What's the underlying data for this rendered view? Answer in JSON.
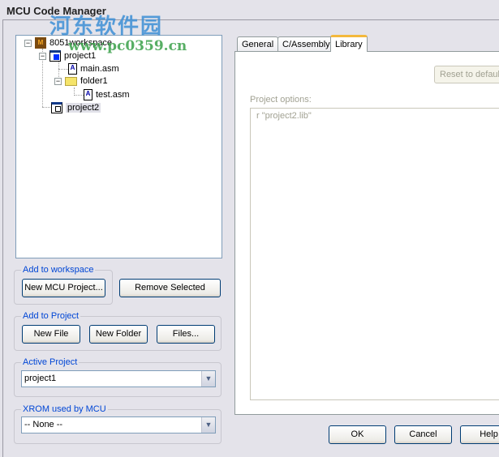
{
  "window": {
    "title": "MCU Code Manager"
  },
  "watermark": {
    "text": "河东软件园",
    "url": "www.pc0359.cn"
  },
  "tree": {
    "workspace": "8051workspace",
    "project1": "project1",
    "main": "main.asm",
    "folder1": "folder1",
    "test": "test.asm",
    "project2": "project2"
  },
  "add_workspace": {
    "label": "Add to workspace",
    "new_project": "New MCU Project...",
    "remove": "Remove Selected"
  },
  "add_project": {
    "label": "Add to Project",
    "new_file": "New File",
    "new_folder": "New Folder",
    "files": "Files..."
  },
  "active_project": {
    "label": "Active Project",
    "value": "project1"
  },
  "xrom": {
    "label": "XROM used by MCU",
    "value": "-- None --"
  },
  "tabs": [
    {
      "label": "General"
    },
    {
      "label": "C/Assembly"
    },
    {
      "label": "Library",
      "active": true
    }
  ],
  "library": {
    "reset": "Reset to default",
    "options_label": "Project options:",
    "options_value": "r \"project2.lib\""
  },
  "footer": {
    "ok": "OK",
    "cancel": "Cancel",
    "help": "Help"
  }
}
